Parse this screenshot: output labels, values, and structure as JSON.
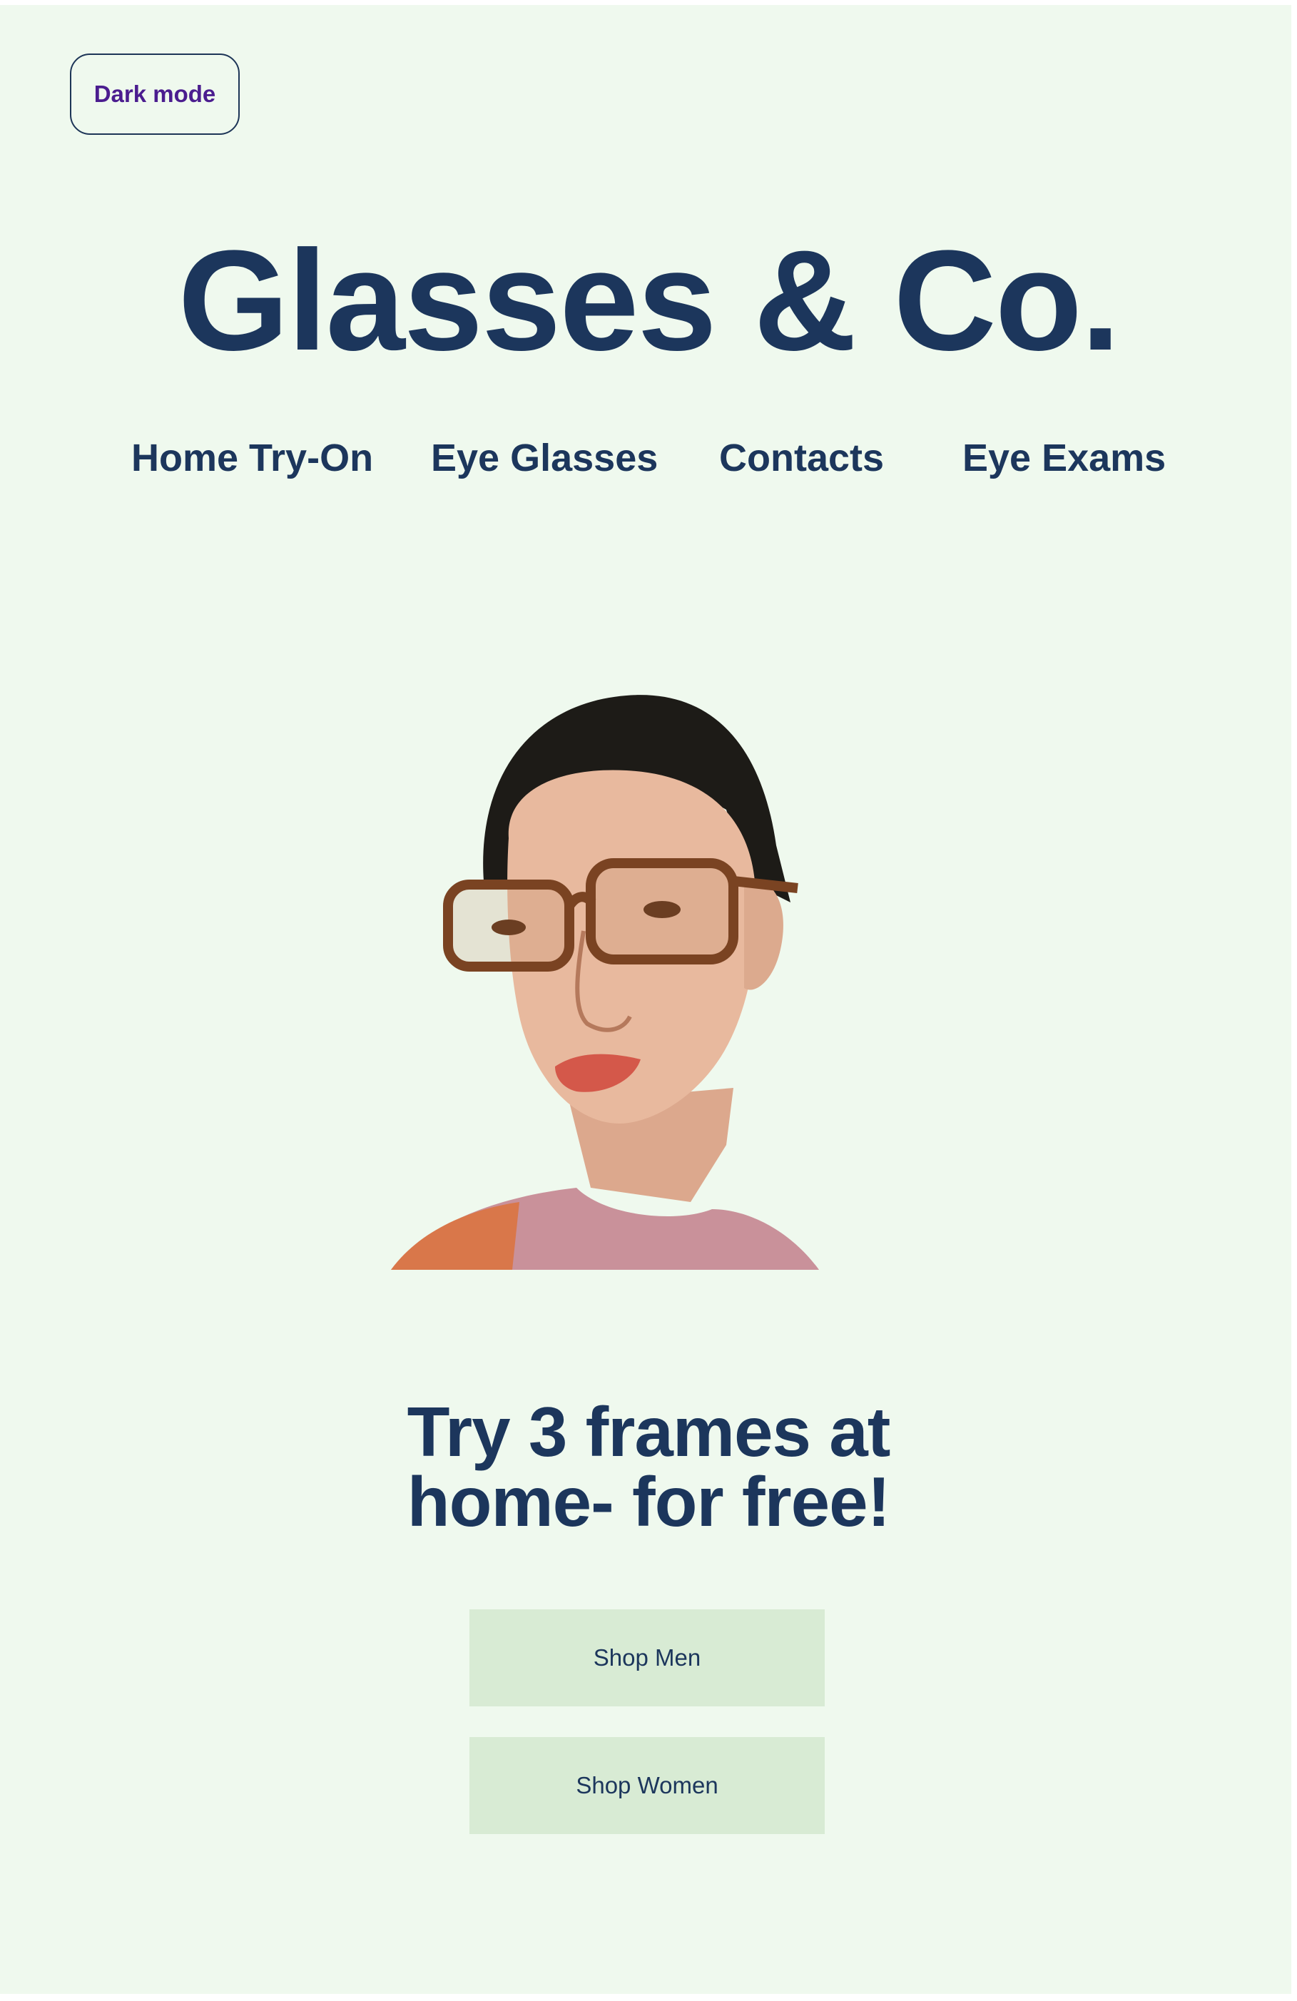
{
  "header": {
    "dark_mode_label": "Dark mode",
    "brand_title": "Glasses & Co."
  },
  "nav": {
    "items": [
      {
        "label": "Home Try-On"
      },
      {
        "label": "Eye Glasses"
      },
      {
        "label": "Contacts"
      },
      {
        "label": "Eye Exams"
      }
    ]
  },
  "hero": {
    "image": "model-with-glasses-portrait",
    "headline_line1": "Try 3 frames at",
    "headline_line2": "home- for free!"
  },
  "actions": {
    "shop_men_label": "Shop Men",
    "shop_women_label": "Shop Women"
  },
  "colors": {
    "background": "#eff9ee",
    "text_primary": "#1c365c",
    "dark_mode_text": "#4b1d8f",
    "button_bg": "#d8ebd4"
  }
}
